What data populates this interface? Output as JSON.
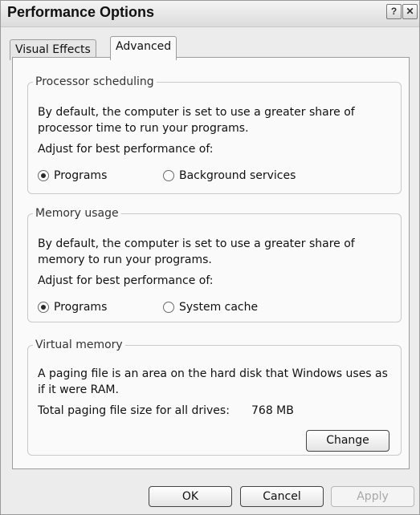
{
  "window": {
    "title": "Performance Options",
    "help_button": "?",
    "close_button": "✕"
  },
  "tabs": [
    {
      "label": "Visual Effects",
      "active": false
    },
    {
      "label": "Advanced",
      "active": true
    }
  ],
  "processor": {
    "legend": "Processor scheduling",
    "description": "By default, the computer is set to use a greater share of processor time to run your programs.",
    "adjust_label": "Adjust for best performance of:",
    "options": [
      {
        "label": "Programs",
        "selected": true
      },
      {
        "label": "Background services",
        "selected": false
      }
    ]
  },
  "memory": {
    "legend": "Memory usage",
    "description": "By default, the computer is set to use a greater share of memory to run your programs.",
    "adjust_label": "Adjust for best performance of:",
    "options": [
      {
        "label": "Programs",
        "selected": true
      },
      {
        "label": "System cache",
        "selected": false
      }
    ]
  },
  "virtual_memory": {
    "legend": "Virtual memory",
    "description": "A paging file is an area on the hard disk that Windows uses as if it were RAM.",
    "total_label": "Total paging file size for all drives:",
    "total_value": "768 MB",
    "change_button": "Change"
  },
  "footer": {
    "ok": "OK",
    "cancel": "Cancel",
    "apply": "Apply",
    "apply_enabled": false
  }
}
